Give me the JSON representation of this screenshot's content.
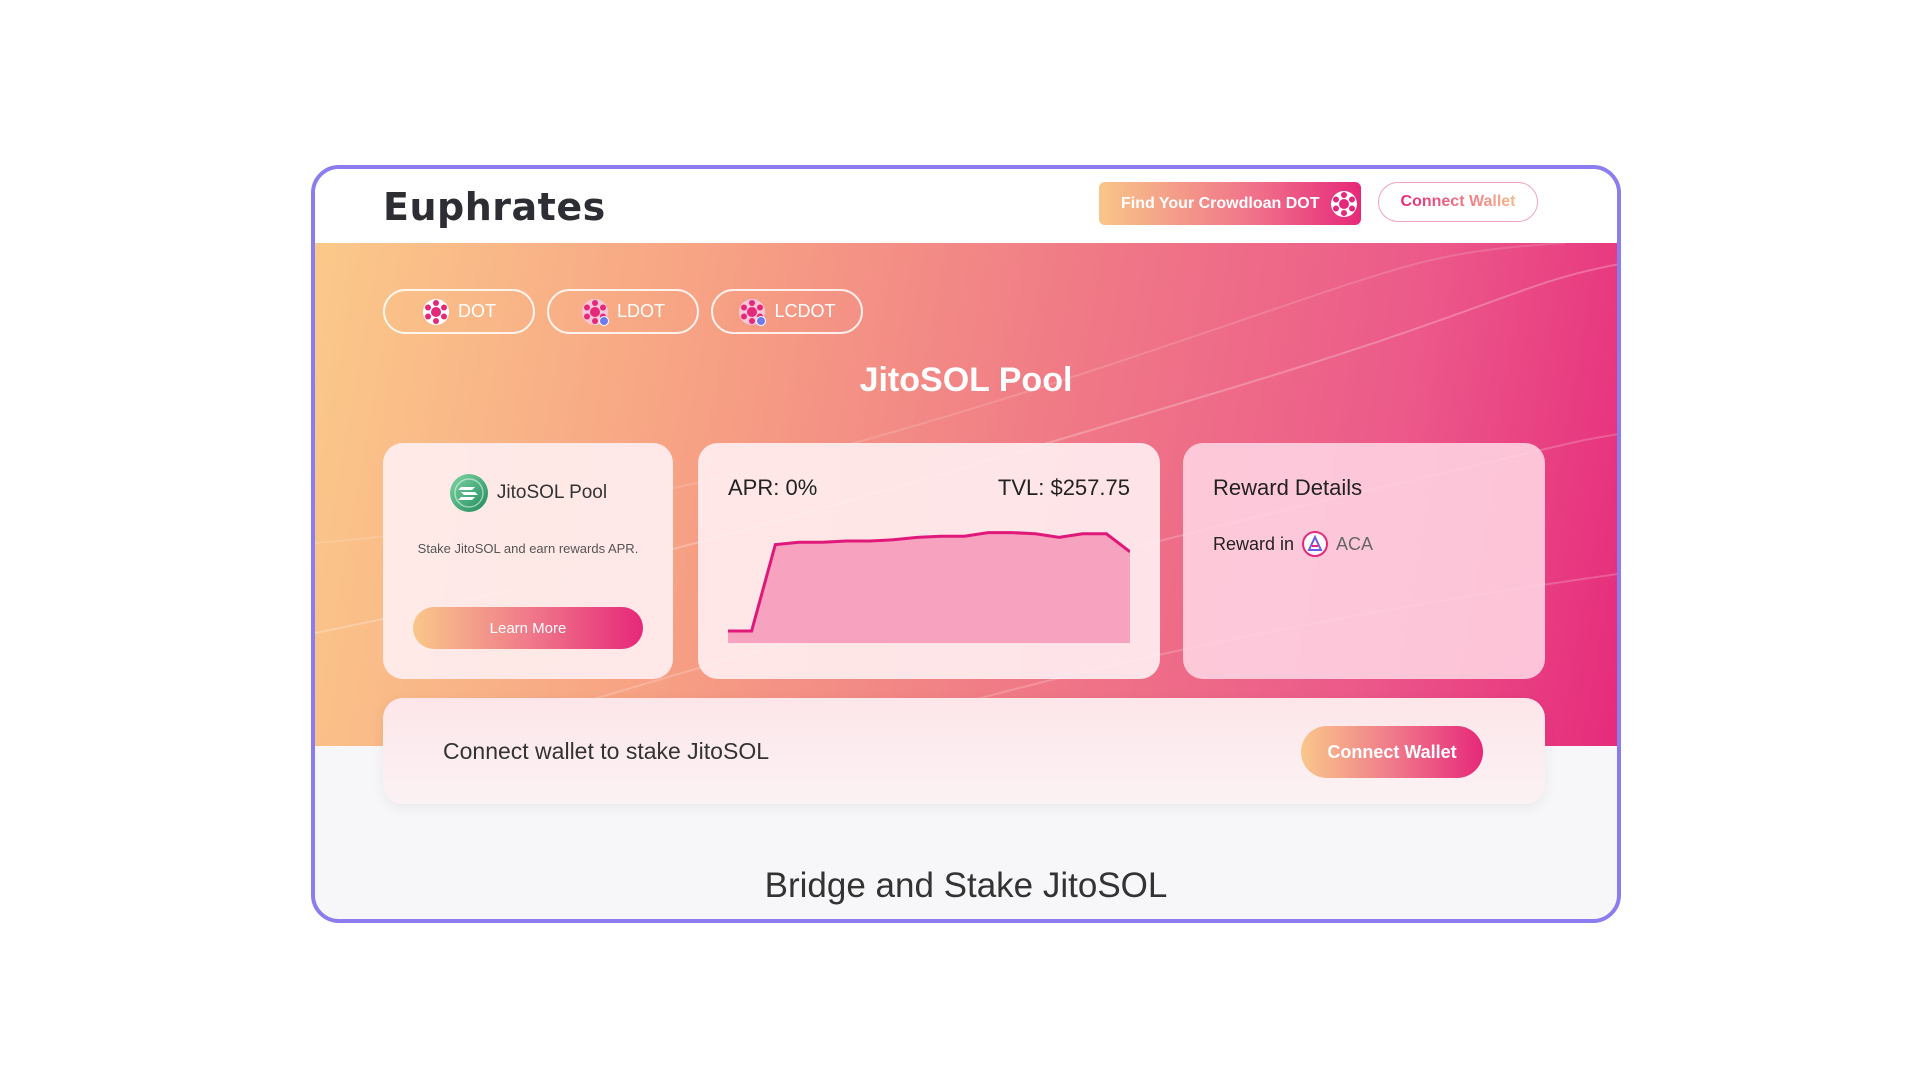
{
  "header": {
    "logo": "Euphrates",
    "crowdloan_button": "Find Your Crowdloan DOT",
    "connect_wallet": "Connect Wallet"
  },
  "tokens": [
    {
      "label": "DOT",
      "icon": "polkadot-icon"
    },
    {
      "label": "LDOT",
      "icon": "ldot-icon"
    },
    {
      "label": "LCDOT",
      "icon": "lcdot-icon"
    }
  ],
  "hero": {
    "title": "JitoSOL Pool"
  },
  "pool_card": {
    "name": "JitoSOL Pool",
    "description": "Stake JitoSOL and earn rewards APR.",
    "learn_more": "Learn More"
  },
  "stats_card": {
    "apr": "APR: 0%",
    "tvl": "TVL: $257.75"
  },
  "reward_card": {
    "title": "Reward Details",
    "reward_label": "Reward in",
    "reward_token": "ACA"
  },
  "stake": {
    "message": "Connect wallet to stake JitoSOL",
    "button": "Connect Wallet"
  },
  "section": {
    "title": "Bridge and Stake JitoSOL"
  },
  "chart_data": {
    "type": "area",
    "title": "",
    "values": [
      10,
      10,
      82,
      84,
      84,
      85,
      85,
      86,
      88,
      89,
      89,
      92,
      92,
      91,
      88,
      91,
      91,
      76
    ],
    "ylim": [
      0,
      100
    ]
  },
  "colors": {
    "accent_pink": "#e6287a",
    "accent_orange": "#f9c78a",
    "frame": "#8b7cf0",
    "chart_line": "#e0187a",
    "chart_fill": "#f7a2bf"
  }
}
